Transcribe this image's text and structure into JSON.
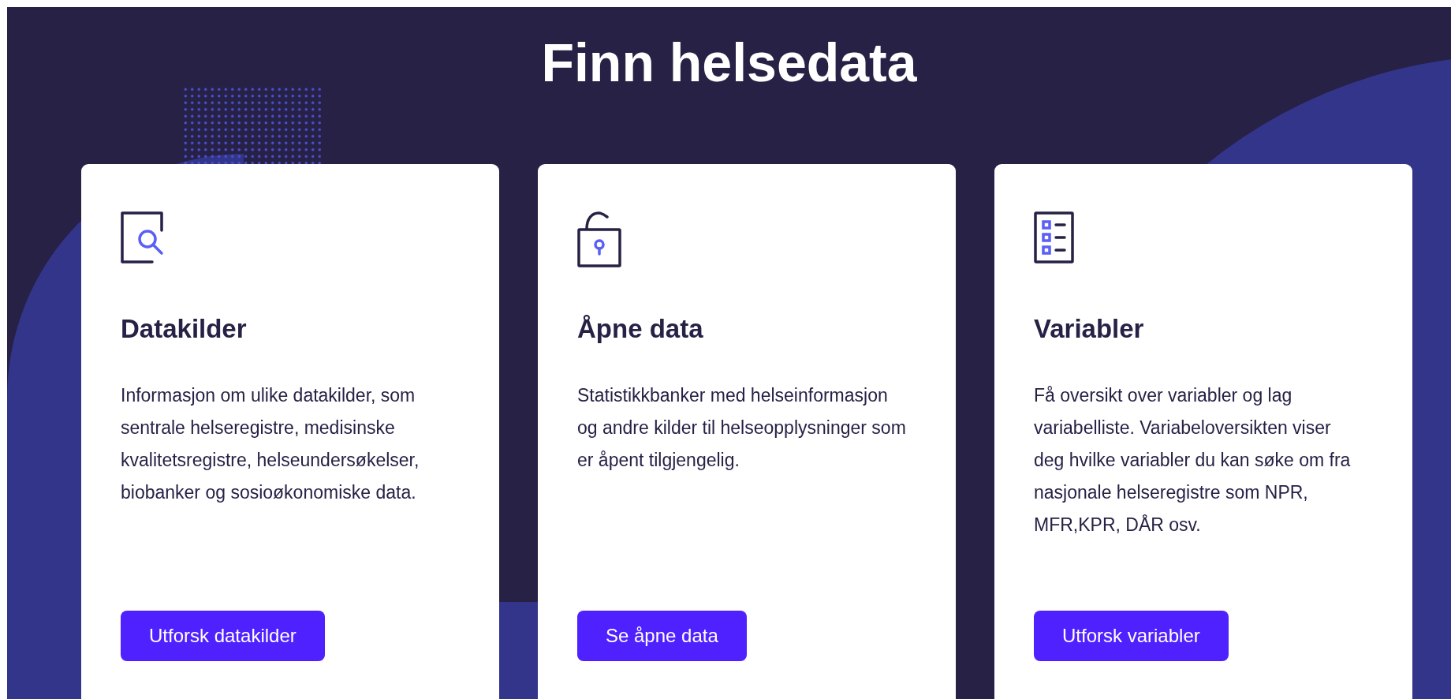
{
  "title": "Finn helsedata",
  "cards": [
    {
      "kind": "search-document",
      "heading": "Datakilder",
      "text": "Informasjon om ulike datakilder, som sentrale helseregistre, medisinske kvalitetsregistre, helseundersøkelser, biobanker og sosioøkonomiske data.",
      "button": "Utforsk datakilder"
    },
    {
      "kind": "unlocked-padlock",
      "heading": "Åpne data",
      "text": "Statistikkbanker med helseinformasjon og andre kilder til helseopplysninger som er åpent tilgjengelig.",
      "button": "Se åpne data"
    },
    {
      "kind": "checklist",
      "heading": "Variabler",
      "text": "Få oversikt over variabler og lag variabelliste. Variabeloversikten viser deg hvilke variabler du kan søke om fra nasjonale helseregistre som NPR, MFR,KPR, DÅR osv.",
      "button": "Utforsk variabler"
    }
  ]
}
